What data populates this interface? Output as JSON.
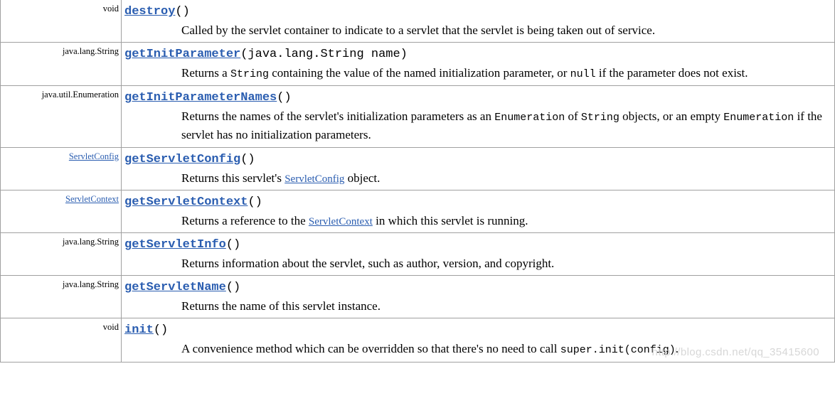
{
  "watermark": "http://blog.csdn.net/qq_35415600",
  "rows": [
    {
      "ret_plain": "void",
      "ret_link": null,
      "method": "destroy",
      "params": "()",
      "desc_before": "Called by the servlet container to indicate to a servlet that the servlet is being taken out of service.",
      "desc_code1": null,
      "desc_mid1": null,
      "desc_code2": null,
      "desc_after": null,
      "inline_link": null,
      "inline_link_after": null
    },
    {
      "ret_plain": "java.lang.String",
      "ret_link": null,
      "method": "getInitParameter",
      "params": "(java.lang.String name)",
      "desc_before": "Returns a ",
      "desc_code1": "String",
      "desc_mid1": " containing the value of the named initialization parameter, or ",
      "desc_code2": "null",
      "desc_after": " if the parameter does not exist.",
      "inline_link": null,
      "inline_link_after": null
    },
    {
      "ret_plain": "java.util.Enumeration",
      "ret_link": null,
      "method": "getInitParameterNames",
      "params": "()",
      "desc_before": "Returns the names of the servlet's initialization parameters as an ",
      "desc_code1": "Enumeration",
      "desc_mid1": " of ",
      "desc_code2": "String",
      "desc_after": " objects, or an empty ",
      "desc_code3": "Enumeration",
      "desc_tail": " if the servlet has no initialization parameters.",
      "inline_link": null,
      "inline_link_after": null
    },
    {
      "ret_plain": null,
      "ret_link": "ServletConfig",
      "method": "getServletConfig",
      "params": "()",
      "desc_before": "Returns this servlet's ",
      "desc_code1": null,
      "desc_mid1": null,
      "desc_code2": null,
      "desc_after": " object.",
      "inline_link": "ServletConfig",
      "inline_link_after": null
    },
    {
      "ret_plain": null,
      "ret_link": "ServletContext",
      "method": "getServletContext",
      "params": "()",
      "desc_before": "Returns a reference to the ",
      "desc_code1": null,
      "desc_mid1": null,
      "desc_code2": null,
      "desc_after": null,
      "inline_link": "ServletContext",
      "inline_link_after": " in which this servlet is running."
    },
    {
      "ret_plain": "java.lang.String",
      "ret_link": null,
      "method": "getServletInfo",
      "params": "()",
      "desc_before": "Returns information about the servlet, such as author, version, and copyright.",
      "desc_code1": null,
      "desc_mid1": null,
      "desc_code2": null,
      "desc_after": null,
      "inline_link": null,
      "inline_link_after": null
    },
    {
      "ret_plain": "java.lang.String",
      "ret_link": null,
      "method": "getServletName",
      "params": "()",
      "desc_before": "Returns the name of this servlet instance.",
      "desc_code1": null,
      "desc_mid1": null,
      "desc_code2": null,
      "desc_after": null,
      "inline_link": null,
      "inline_link_after": null
    },
    {
      "ret_plain": "void",
      "ret_link": null,
      "method": "init",
      "params": "()",
      "desc_before": "A convenience method which can be overridden so that there's no need to call ",
      "desc_code1": "super.init(config)",
      "desc_mid1": ".",
      "desc_code2": null,
      "desc_after": null,
      "inline_link": null,
      "inline_link_after": null
    }
  ]
}
